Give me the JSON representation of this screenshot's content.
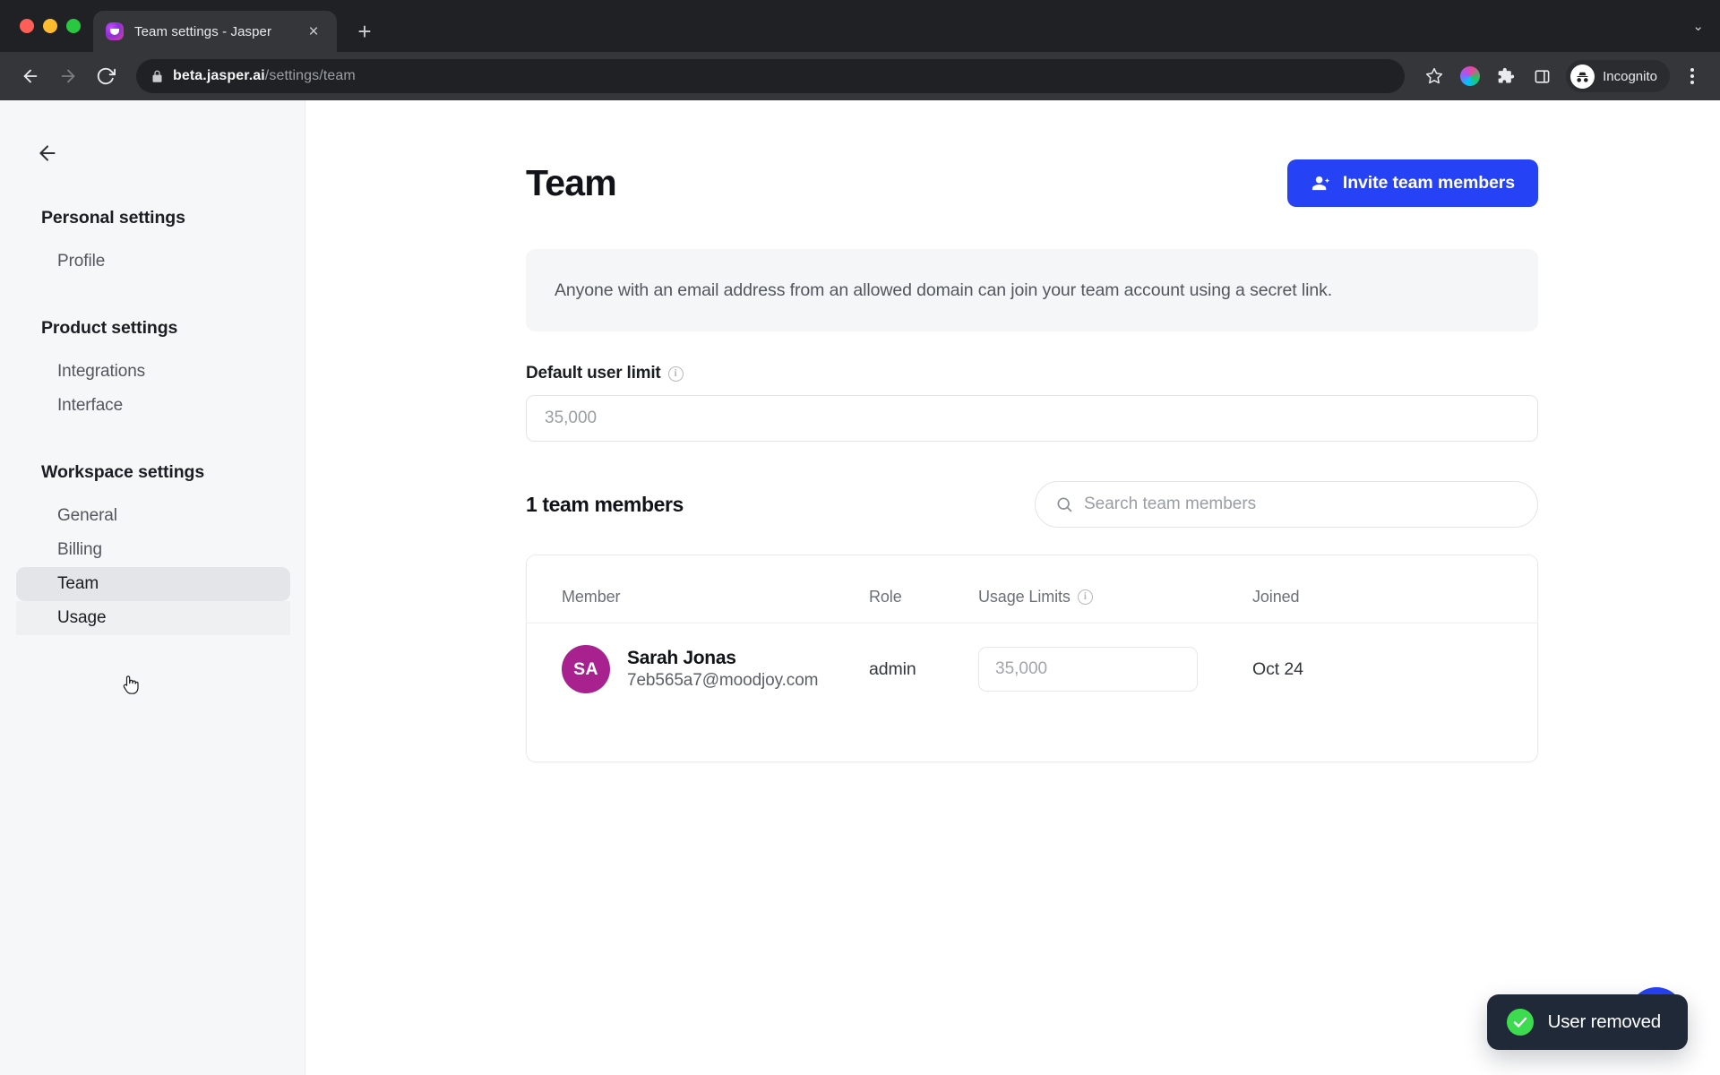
{
  "browser": {
    "tab": {
      "title": "Team settings - Jasper",
      "favicon": "jasper-favicon",
      "close": "×"
    },
    "new_tab_label": "+",
    "tab_list_chevron": "⌄",
    "url": {
      "domain": "beta.jasper.ai",
      "path": "/settings/team"
    },
    "profile": {
      "label": "Incognito"
    },
    "icons": {
      "back": "back-arrow-icon",
      "forward": "forward-arrow-icon",
      "reload": "reload-icon",
      "lock": "lock-icon",
      "bookmark": "star-icon",
      "extension": "puzzle-icon",
      "side_panel": "side-panel-icon",
      "menu": "three-dots-icon"
    }
  },
  "sidebar": {
    "back_icon": "back-arrow-icon",
    "groups": [
      {
        "heading": "Personal settings",
        "items": [
          {
            "label": "Profile",
            "state": "default"
          }
        ]
      },
      {
        "heading": "Product settings",
        "items": [
          {
            "label": "Integrations",
            "state": "default"
          },
          {
            "label": "Interface",
            "state": "default"
          }
        ]
      },
      {
        "heading": "Workspace settings",
        "items": [
          {
            "label": "General",
            "state": "default"
          },
          {
            "label": "Billing",
            "state": "default"
          },
          {
            "label": "Team",
            "state": "selected"
          },
          {
            "label": "Usage",
            "state": "hover"
          }
        ]
      }
    ]
  },
  "main": {
    "title": "Team",
    "invite_button": {
      "label": "Invite team members",
      "icon": "person-add-icon"
    },
    "notice": "Anyone with an email address from an allowed domain can join your team account using a secret link.",
    "default_user_limit": {
      "label": "Default user limit",
      "info_icon": "info-icon",
      "value": "",
      "placeholder": "35,000"
    },
    "members_count_label": "1 team members",
    "search": {
      "placeholder": "Search team members",
      "value": "",
      "icon": "search-icon"
    },
    "table": {
      "columns": [
        {
          "key": "member",
          "label": "Member"
        },
        {
          "key": "role",
          "label": "Role"
        },
        {
          "key": "usage",
          "label": "Usage Limits",
          "info_icon": "info-icon"
        },
        {
          "key": "joined",
          "label": "Joined"
        }
      ],
      "rows": [
        {
          "initials": "SA",
          "avatar_color": "#a7218f",
          "name": "Sarah Jonas",
          "email": "7eb565a7@moodjoy.com",
          "role": "admin",
          "usage_limit_value": "",
          "usage_limit_placeholder": "35,000",
          "joined": "Oct 24"
        }
      ]
    }
  },
  "toast": {
    "message": "User removed",
    "icon": "check-circle-icon"
  },
  "fab": {
    "name": "help-fab"
  },
  "colors": {
    "accent_blue": "#2642f5",
    "toast_bg": "#1f2937",
    "toast_check": "#3ddb4f",
    "avatar_magenta": "#a7218f",
    "sidebar_bg": "#f6f7f9",
    "selected_nav_bg": "#e3e5e8"
  }
}
